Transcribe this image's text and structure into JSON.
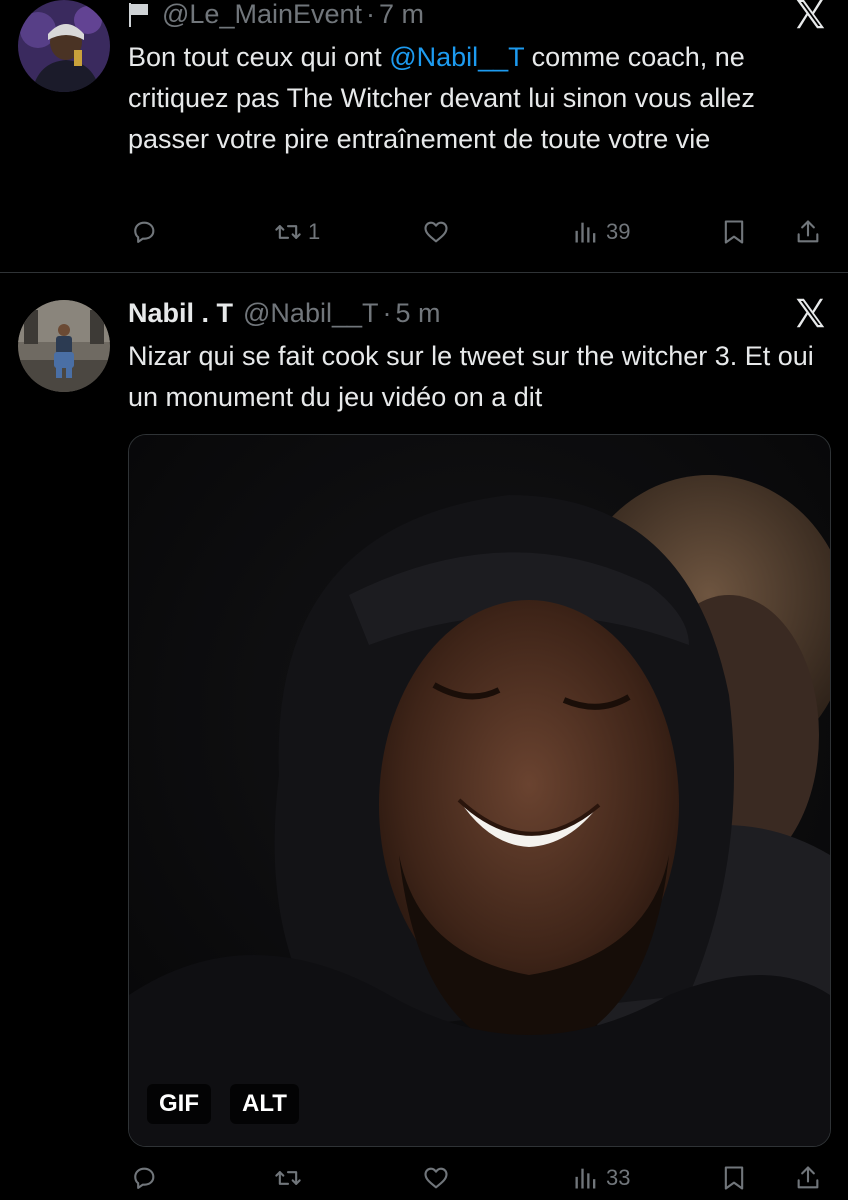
{
  "tweets": [
    {
      "handle": "@Le_MainEvent",
      "separator": "·",
      "time": "7 m",
      "text_before": "Bon tout ceux qui ont ",
      "mention": "@Nabil__T",
      "text_after": " comme coach, ne critiquez pas The Witcher devant lui sinon vous allez passer votre pire entraînement de toute votre vie",
      "reposts": "1",
      "views": "39",
      "icons": [
        "flag-icon",
        "x-logo-icon",
        "reply-icon",
        "repost-icon",
        "like-icon",
        "views-icon",
        "bookmark-icon",
        "share-icon"
      ]
    },
    {
      "display_name": "Nabil . T",
      "handle": "@Nabil__T",
      "separator": "·",
      "time": "5 m",
      "text": "Nizar qui se fait cook sur le tweet sur the witcher 3. Et oui un monument du jeu vidéo on a dit",
      "media_badges": {
        "gif": "GIF",
        "alt": "ALT"
      },
      "views": "33",
      "icons": [
        "x-logo-icon",
        "reply-icon",
        "repost-icon",
        "like-icon",
        "views-icon",
        "bookmark-icon",
        "share-icon"
      ]
    }
  ],
  "colors": {
    "background": "#000000",
    "text": "#e7e9ea",
    "secondary_text": "#71767b",
    "mention": "#1d9bf0",
    "divider": "#2f3336"
  }
}
